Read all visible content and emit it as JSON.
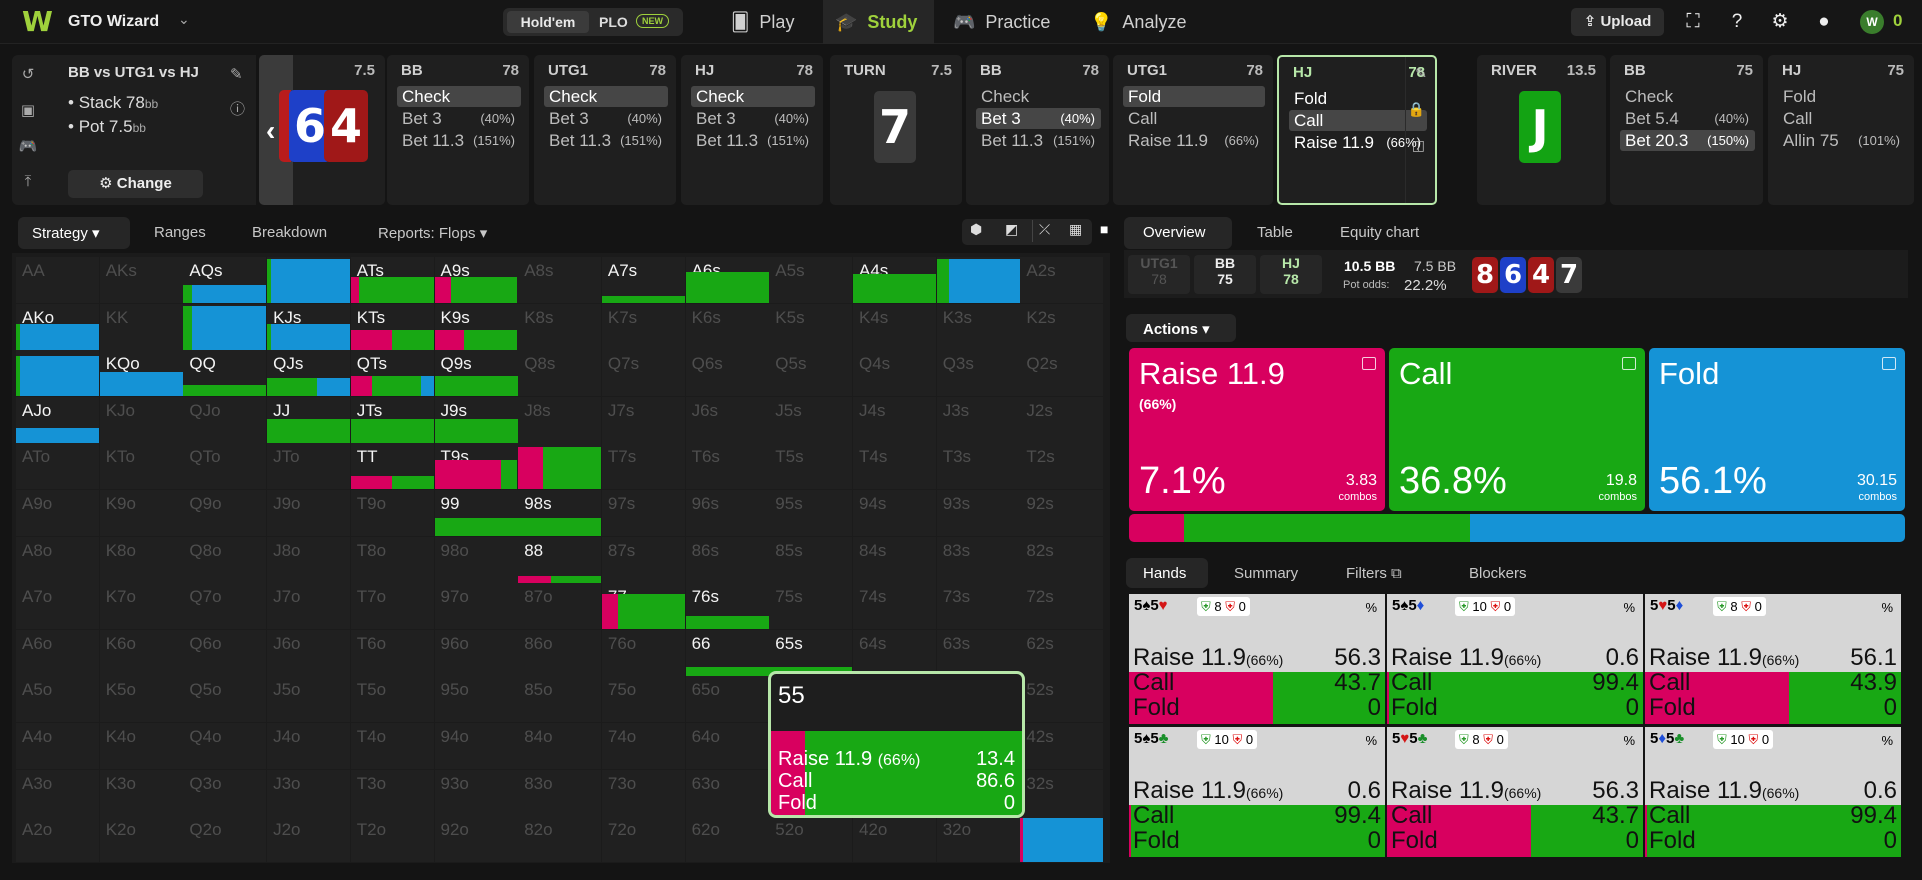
{
  "colors": {
    "raise": "#d8005f",
    "call": "#18a814",
    "fold": "#1593d6",
    "accent": "#9fd13c",
    "tooltip_border": "#b7e7a9"
  },
  "topbar": {
    "brand": "GTO Wizard",
    "game_toggle": {
      "holdem": "Hold'em",
      "plo": "PLO",
      "new_badge": "NEW"
    },
    "nav": [
      {
        "label": "Play",
        "icon": "cards-icon"
      },
      {
        "label": "Study",
        "icon": "graduation-cap-icon"
      },
      {
        "label": "Practice",
        "icon": "gamepad-icon"
      },
      {
        "label": "Analyze",
        "icon": "lightbulb-icon"
      }
    ],
    "upload": "Upload",
    "coins": "0"
  },
  "info": {
    "title": "BB vs UTG1 vs HJ",
    "stack": "Stack 78",
    "stack_unit": "bb",
    "pot": "Pot 7.5",
    "pot_unit": "bb",
    "change": "Change"
  },
  "flop_cards": {
    "pot": "7.5",
    "c1": "6",
    "c2": "4"
  },
  "players": [
    {
      "pos": "BB",
      "stack": "78",
      "actions": [
        {
          "l": "Check",
          "p": "",
          "sel": true
        },
        {
          "l": "Bet 3",
          "p": "(40%)"
        },
        {
          "l": "Bet 11.3",
          "p": "(151%)"
        }
      ]
    },
    {
      "pos": "UTG1",
      "stack": "78",
      "actions": [
        {
          "l": "Check",
          "p": "",
          "sel": true
        },
        {
          "l": "Bet 3",
          "p": "(40%)"
        },
        {
          "l": "Bet 11.3",
          "p": "(151%)"
        }
      ]
    },
    {
      "pos": "HJ",
      "stack": "78",
      "actions": [
        {
          "l": "Check",
          "p": "",
          "sel": true
        },
        {
          "l": "Bet 3",
          "p": "(40%)"
        },
        {
          "l": "Bet 11.3",
          "p": "(151%)"
        }
      ]
    },
    {
      "pos": "BB",
      "stack": "78",
      "actions": [
        {
          "l": "Check",
          "p": ""
        },
        {
          "l": "Bet 3",
          "p": "(40%)",
          "sel": true
        },
        {
          "l": "Bet 11.3",
          "p": "(151%)"
        }
      ]
    },
    {
      "pos": "UTG1",
      "stack": "78",
      "actions": [
        {
          "l": "Fold",
          "p": "",
          "sel": true
        },
        {
          "l": "Call",
          "p": ""
        },
        {
          "l": "Raise 11.9",
          "p": "(66%)"
        }
      ]
    },
    {
      "pos": "HJ",
      "stack": "78",
      "actions": [
        {
          "l": "Fold",
          "p": ""
        },
        {
          "l": "Call",
          "p": "",
          "sel": true
        },
        {
          "l": "Raise 11.9",
          "p": "(66%)"
        }
      ]
    },
    {
      "pos": "BB",
      "stack": "75",
      "actions": [
        {
          "l": "Check",
          "p": ""
        },
        {
          "l": "Bet 5.4",
          "p": "(40%)"
        },
        {
          "l": "Bet 20.3",
          "p": "(150%)",
          "sel": true
        }
      ]
    },
    {
      "pos": "HJ",
      "stack": "75",
      "actions": [
        {
          "l": "Fold",
          "p": ""
        },
        {
          "l": "Call",
          "p": ""
        },
        {
          "l": "Allin 75",
          "p": "(101%)"
        }
      ]
    }
  ],
  "turn": {
    "label": "TURN",
    "pot": "7.5",
    "card": "7"
  },
  "river": {
    "label": "RIVER",
    "pot": "13.5",
    "card": "J"
  },
  "left_tabs": [
    "Strategy",
    "Ranges",
    "Breakdown",
    "Reports: Flops"
  ],
  "grid_ranks": [
    "A",
    "K",
    "Q",
    "J",
    "T",
    "9",
    "8",
    "7",
    "6",
    "5",
    "4",
    "3",
    "2"
  ],
  "grid_strategy": {
    "AQs": [
      0,
      10,
      90
    ],
    "AJs": [
      0,
      5,
      95
    ],
    "ATs": [
      10,
      90,
      0
    ],
    "A9s": [
      20,
      80,
      0
    ],
    "A7s": [
      0,
      100,
      0
    ],
    "A6s": [
      0,
      100,
      0
    ],
    "A4s": [
      0,
      100,
      0
    ],
    "A3s": [
      0,
      15,
      85
    ],
    "AKo": [
      0,
      5,
      95
    ],
    "KQs": [
      0,
      10,
      90
    ],
    "KJs": [
      0,
      5,
      95
    ],
    "KTs": [
      50,
      50,
      0
    ],
    "K9s": [
      35,
      65,
      0
    ],
    "AQo": [
      0,
      5,
      95
    ],
    "KQo": [
      0,
      0,
      100
    ],
    "QQ": [
      0,
      100,
      0
    ],
    "QJs": [
      0,
      60,
      40
    ],
    "QTs": [
      25,
      60,
      15
    ],
    "Q9s": [
      0,
      100,
      0
    ],
    "AJo": [
      0,
      0,
      100
    ],
    "JJ": [
      0,
      100,
      0
    ],
    "JTs": [
      0,
      100,
      0
    ],
    "J9s": [
      0,
      100,
      0
    ],
    "TT": [
      50,
      50,
      0
    ],
    "T9s": [
      80,
      20,
      0
    ],
    "T8s": [
      30,
      70,
      0
    ],
    "99": [
      0,
      100,
      0
    ],
    "98s": [
      0,
      100,
      0
    ],
    "88": [
      40,
      60,
      0
    ],
    "77": [
      20,
      80,
      0
    ],
    "76s": [
      0,
      100,
      0
    ],
    "66": [
      0,
      100,
      0
    ],
    "65s": [
      0,
      100,
      0
    ],
    "55": [
      13.4,
      86.6,
      0
    ],
    "22": [
      3,
      0,
      97
    ]
  },
  "grid_bar_fill": {
    "AQs": 0.4,
    "AJs": 1.0,
    "ATs": 0.6,
    "A9s": 0.6,
    "A7s": 0.15,
    "A6s": 0.7,
    "A4s": 0.65,
    "A3s": 1.0,
    "AKo": 0.6,
    "KQs": 1.0,
    "KJs": 0.6,
    "KTs": 0.45,
    "K9s": 0.45,
    "AQo": 0.9,
    "KQo": 0.55,
    "QQ": 0.25,
    "QJs": 0.4,
    "QTs": 0.45,
    "Q9s": 0.45,
    "AJo": 0.35,
    "JJ": 0.55,
    "JTs": 0.55,
    "J9s": 0.55,
    "TT": 0.3,
    "T9s": 0.65,
    "T8s": 0.95,
    "99": 0.4,
    "98s": 0.4,
    "88": 0.15,
    "77": 0.8,
    "76s": 0.3,
    "66": 0.2,
    "65s": 0.2,
    "22": 1.0
  },
  "tooltip": {
    "hand": "55",
    "raise_label": "Raise 11.9",
    "raise_pct": "(66%)",
    "raise_val": "13.4",
    "call_label": "Call",
    "call_val": "86.6",
    "fold_label": "Fold",
    "fold_val": "0"
  },
  "right_tabs": [
    "Overview",
    "Table",
    "Equity chart"
  ],
  "potbar": {
    "utg1": {
      "pos": "UTG1",
      "stack": "78"
    },
    "bb": {
      "pos": "BB",
      "stack": "75"
    },
    "hj": {
      "pos": "HJ",
      "stack": "78"
    },
    "pot": "10.5 BB",
    "pot2": "7.5 BB",
    "pot_odds_label": "Pot odds:",
    "pot_odds": "22.2%",
    "board": [
      "8",
      "6",
      "4",
      "7"
    ]
  },
  "actions_header": "Actions",
  "action_cards": [
    {
      "name": "Raise 11.9",
      "sub": "(66%)",
      "pct": "7.1%",
      "combos": "3.83",
      "combos_label": "combos",
      "freq": 7.1
    },
    {
      "name": "Call",
      "sub": "",
      "pct": "36.8%",
      "combos": "19.8",
      "combos_label": "combos",
      "freq": 36.8
    },
    {
      "name": "Fold",
      "sub": "",
      "pct": "56.1%",
      "combos": "30.15",
      "combos_label": "combos",
      "freq": 56.1
    }
  ],
  "hands_tabs": [
    "Hands",
    "Summary",
    "Filters",
    "Blockers"
  ],
  "hand_cards": [
    {
      "c1": "5",
      "s1": "♠",
      "c2": "5",
      "s2": "♥",
      "b1": "8",
      "b2": "0",
      "raise": "56.3",
      "call": "43.7",
      "fold": "0"
    },
    {
      "c1": "5",
      "s1": "♠",
      "c2": "5",
      "s2": "♦",
      "b1": "10",
      "b2": "0",
      "raise": "0.6",
      "call": "99.4",
      "fold": "0"
    },
    {
      "c1": "5",
      "s1": "♥",
      "c2": "5",
      "s2": "♦",
      "b1": "8",
      "b2": "0",
      "raise": "56.1",
      "call": "43.9",
      "fold": "0"
    },
    {
      "c1": "5",
      "s1": "♠",
      "c2": "5",
      "s2": "♣",
      "b1": "10",
      "b2": "0",
      "raise": "0.6",
      "call": "99.4",
      "fold": "0"
    },
    {
      "c1": "5",
      "s1": "♥",
      "c2": "5",
      "s2": "♣",
      "b1": "8",
      "b2": "0",
      "raise": "56.3",
      "call": "43.7",
      "fold": "0"
    },
    {
      "c1": "5",
      "s1": "♦",
      "c2": "5",
      "s2": "♣",
      "b1": "10",
      "b2": "0",
      "raise": "0.6",
      "call": "99.4",
      "fold": "0"
    }
  ],
  "hand_row_labels": {
    "raise": "Raise 11.9",
    "raise_pct": "(66%)",
    "call": "Call",
    "fold": "Fold",
    "pct": "%"
  }
}
